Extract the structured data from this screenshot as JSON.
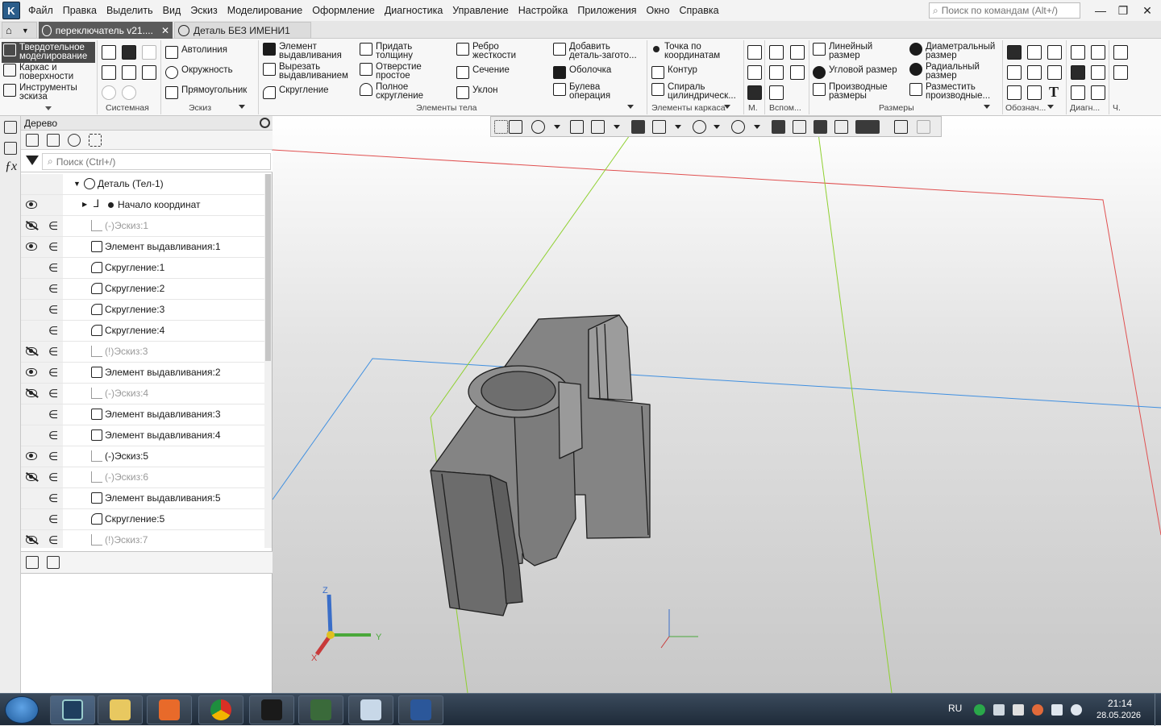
{
  "menubar": {
    "items": [
      "Файл",
      "Правка",
      "Выделить",
      "Вид",
      "Эскиз",
      "Моделирование",
      "Оформление",
      "Диагностика",
      "Управление",
      "Настройка",
      "Приложения",
      "Окно",
      "Справка"
    ],
    "search_placeholder": "Поиск по командам (Alt+/)"
  },
  "tabs": [
    {
      "label": "переключатель v21....",
      "active": true
    },
    {
      "label": "Деталь БЕЗ ИМЕНИ1",
      "active": false
    }
  ],
  "ribbon": {
    "modes": [
      "Твердотельное\nмоделирование",
      "Каркас и\nповерхности",
      "Инструменты\nэскиза"
    ],
    "sketch": [
      "Автолиния",
      "Окружность",
      "Прямоугольник"
    ],
    "body_elements": [
      "Элемент\nвыдавливания",
      "Вырезать\nвыдавливанием",
      "Скругление",
      "Придать\nтолщину",
      "Отверстие\nпростое",
      "Полное\nскругление",
      "Ребро\nжесткости",
      "Сечение",
      "Уклон",
      "Добавить\nдеталь-загото...",
      "Оболочка",
      "Булева\nоперация"
    ],
    "wireframe": [
      "Точка по\nкоординатам",
      "Контур",
      "Спираль\nцилиндрическ..."
    ],
    "dimensions": [
      "Линейный\nразмер",
      "Угловой размер",
      "Производные\nразмеры",
      "Диаметральный\nразмер",
      "Радиальный\nразмер",
      "Разместить\nпроизводные..."
    ],
    "group_labels": [
      "Системная",
      "Эскиз",
      "Элементы тела",
      "Элементы каркаса",
      "М.",
      "Вспом...",
      "Размеры",
      "Обознач...",
      "Диагн...",
      "Ч."
    ]
  },
  "tree": {
    "title": "Дерево",
    "search_placeholder": "Поиск (Ctrl+/)",
    "root": "Деталь (Тел-1)",
    "rows": [
      {
        "label": "Начало координат",
        "eye": "on",
        "incl": false,
        "dim": false,
        "icon": "origin"
      },
      {
        "label": "(-)Эскиз:1",
        "eye": "off",
        "incl": true,
        "dim": true,
        "icon": "sketch"
      },
      {
        "label": "Элемент выдавливания:1",
        "eye": "on",
        "incl": true,
        "dim": false,
        "icon": "extrude"
      },
      {
        "label": "Скругление:1",
        "eye": "none",
        "incl": true,
        "dim": false,
        "icon": "fillet"
      },
      {
        "label": "Скругление:2",
        "eye": "none",
        "incl": true,
        "dim": false,
        "icon": "fillet"
      },
      {
        "label": "Скругление:3",
        "eye": "none",
        "incl": true,
        "dim": false,
        "icon": "fillet"
      },
      {
        "label": "Скругление:4",
        "eye": "none",
        "incl": true,
        "dim": false,
        "icon": "fillet"
      },
      {
        "label": "(!)Эскиз:3",
        "eye": "off",
        "incl": true,
        "dim": true,
        "icon": "sketch"
      },
      {
        "label": "Элемент выдавливания:2",
        "eye": "on",
        "incl": true,
        "dim": false,
        "icon": "extrude"
      },
      {
        "label": "(-)Эскиз:4",
        "eye": "off",
        "incl": true,
        "dim": true,
        "icon": "sketch"
      },
      {
        "label": "Элемент выдавливания:3",
        "eye": "none",
        "incl": true,
        "dim": false,
        "icon": "cut"
      },
      {
        "label": "Элемент выдавливания:4",
        "eye": "none",
        "incl": true,
        "dim": false,
        "icon": "cut"
      },
      {
        "label": "(-)Эскиз:5",
        "eye": "on",
        "incl": true,
        "dim": false,
        "icon": "sketch"
      },
      {
        "label": "(-)Эскиз:6",
        "eye": "off",
        "incl": true,
        "dim": true,
        "icon": "sketch"
      },
      {
        "label": "Элемент выдавливания:5",
        "eye": "none",
        "incl": true,
        "dim": false,
        "icon": "cut"
      },
      {
        "label": "Скругление:5",
        "eye": "none",
        "incl": true,
        "dim": false,
        "icon": "fillet"
      },
      {
        "label": "(!)Эскиз:7",
        "eye": "off",
        "incl": true,
        "dim": true,
        "icon": "sketch"
      }
    ]
  },
  "viewport": {
    "axis_labels": {
      "x": "X",
      "y": "Y",
      "z": "Z"
    },
    "colors": {
      "plane_red": "#e05050",
      "plane_blue": "#3f8fe0",
      "plane_green": "#8fd030",
      "model": "#7a7a7a"
    }
  },
  "taskbar": {
    "lang": "RU",
    "time": "21:14",
    "date": "28.05.2026",
    "apps": [
      "kompas-3d",
      "file-explorer",
      "media-player",
      "chrome",
      "counter-strike",
      "task-manager",
      "calculator",
      "word"
    ]
  }
}
